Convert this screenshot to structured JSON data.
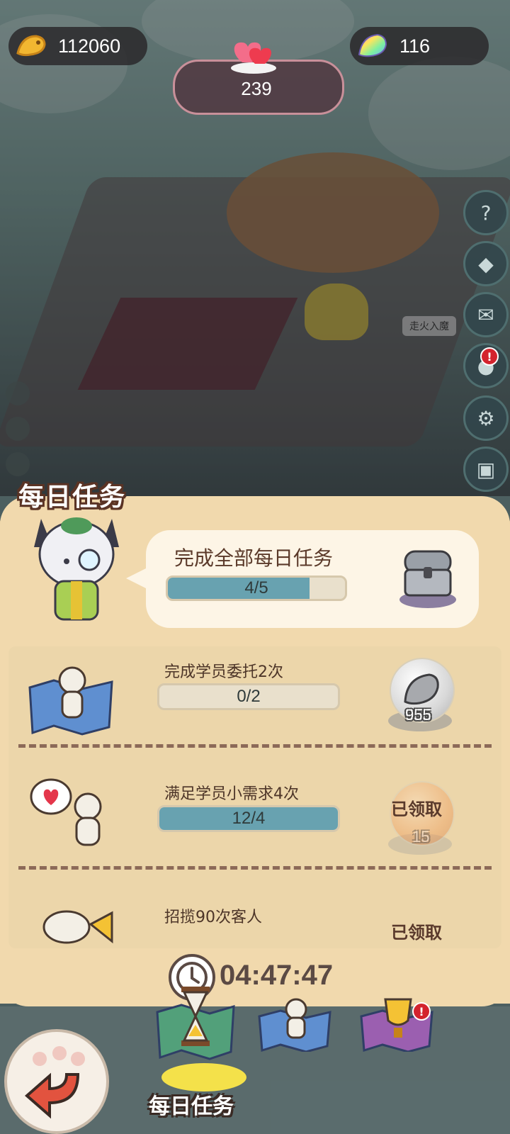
{
  "resources": {
    "fish_value": "112060",
    "gem_value": "116",
    "heart_value": "239"
  },
  "scene": {
    "sign_text": "走火入魔"
  },
  "daily": {
    "panel_title": "每日任务",
    "summary": {
      "title": "完成全部每日任务",
      "progress_text": "4/5",
      "progress_fraction": 0.8
    },
    "tasks": [
      {
        "name": "完成学员委托2次",
        "progress_text": "0/2",
        "progress_fraction": 0.0,
        "reward_value": "955",
        "claimed_label": ""
      },
      {
        "name": "满足学员小需求4次",
        "progress_text": "12/4",
        "progress_fraction": 1.0,
        "reward_value": "15",
        "claimed_label": "已领取"
      },
      {
        "name": "招揽90次客人",
        "progress_text": "",
        "progress_fraction": 1.0,
        "reward_value": "",
        "claimed_label": "已领取"
      }
    ],
    "timer": "04:47:47"
  },
  "bottom_nav": {
    "active_tab_label": "每日任务"
  },
  "colors": {
    "panel_bg": "#f1d9ad",
    "progress_fill": "#68a2b0",
    "text_brown": "#5b3a2a"
  }
}
